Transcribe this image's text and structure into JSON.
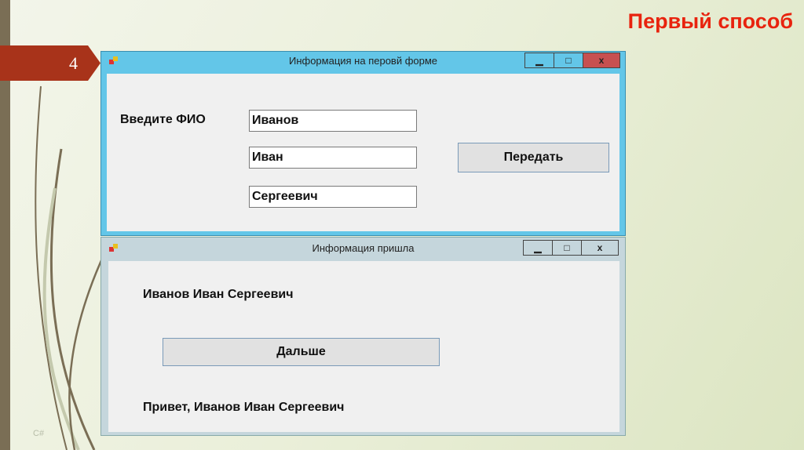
{
  "slide": {
    "title": "Первый способ",
    "number": "4",
    "footer": "C#"
  },
  "form1": {
    "title": "Информация на перовй форме",
    "label": "Введите ФИО",
    "last_name": "Иванов",
    "first_name": "Иван",
    "patronymic": "Сергеевич",
    "send_button": "Передать",
    "minimize": "▁",
    "maximize": "□",
    "close": "x"
  },
  "form2": {
    "title": "Информация пришла",
    "full_name": "Иванов Иван Сергеевич",
    "next_button": "Дальше",
    "greeting": "Привет, Иванов Иван Сергеевич",
    "minimize": "▁",
    "maximize": "□",
    "close": "x"
  },
  "colors": {
    "accent": "#e8230e",
    "tab": "#a8331a",
    "active_title": "#63c6e8",
    "inactive_title": "#c5d6dc"
  }
}
